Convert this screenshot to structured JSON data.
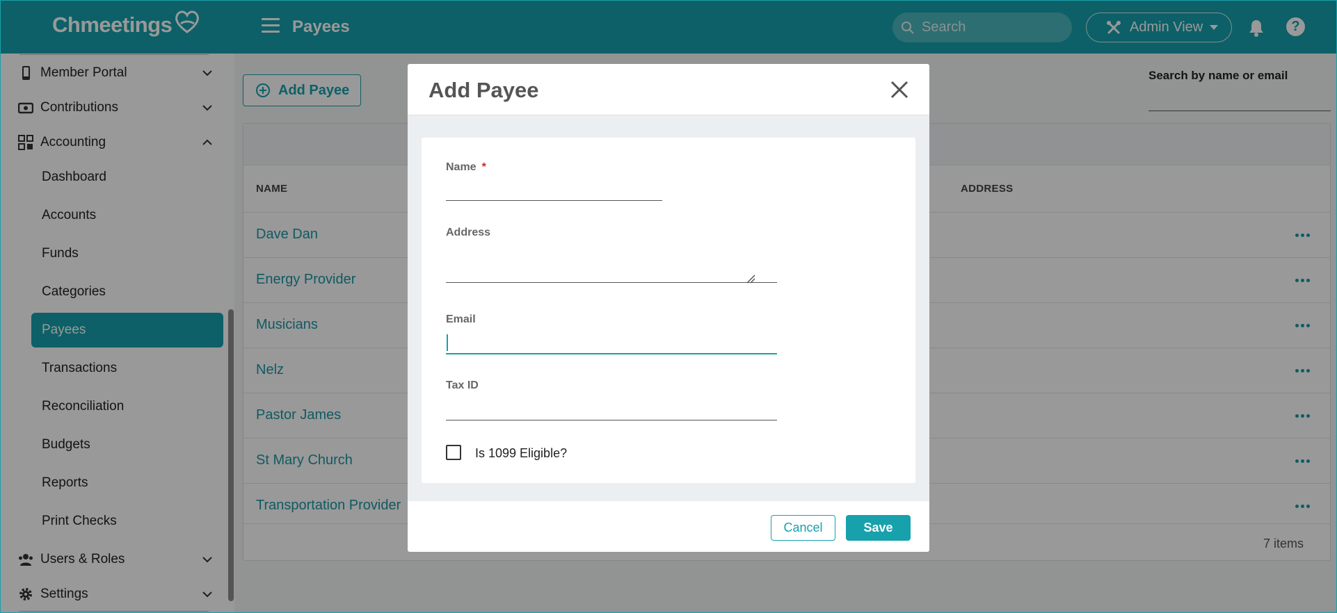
{
  "colors": {
    "brand": "#17a1ac",
    "link": "#1b96a3",
    "required": "#c62828"
  },
  "topbar": {
    "logo": "Chmeetings",
    "page_title": "Payees",
    "search_placeholder": "Search",
    "admin_view": "Admin View"
  },
  "sidebar": {
    "top_items": [
      {
        "label": "Member Portal",
        "icon": "phone-icon"
      },
      {
        "label": "Contributions",
        "icon": "money-icon"
      },
      {
        "label": "Accounting",
        "icon": "accounting-icon"
      }
    ],
    "sub_items": [
      "Dashboard",
      "Accounts",
      "Funds",
      "Categories",
      "Payees",
      "Transactions",
      "Reconciliation",
      "Budgets",
      "Reports",
      "Print Checks"
    ],
    "active_sub": "Payees",
    "bottom_items": [
      {
        "label": "Users & Roles",
        "icon": "users-icon"
      },
      {
        "label": "Settings",
        "icon": "gear-icon"
      }
    ]
  },
  "main": {
    "add_button": "Add Payee",
    "search_label": "Search by name or email",
    "columns": {
      "name": "NAME",
      "address": "ADDRESS"
    },
    "rows": [
      "Dave Dan",
      "Energy Provider",
      "Musicians",
      "Nelz",
      "Pastor James",
      "St Mary Church",
      "Transportation Provider"
    ],
    "items_count": "7 items"
  },
  "modal": {
    "title": "Add Payee",
    "fields": {
      "name_label": "Name",
      "name_required": "*",
      "name_value": "",
      "address_label": "Address",
      "address_value": "",
      "email_label": "Email",
      "email_value": "",
      "taxid_label": "Tax ID",
      "taxid_value": ""
    },
    "checkbox_label": "Is 1099 Eligible?",
    "cancel": "Cancel",
    "save": "Save"
  }
}
